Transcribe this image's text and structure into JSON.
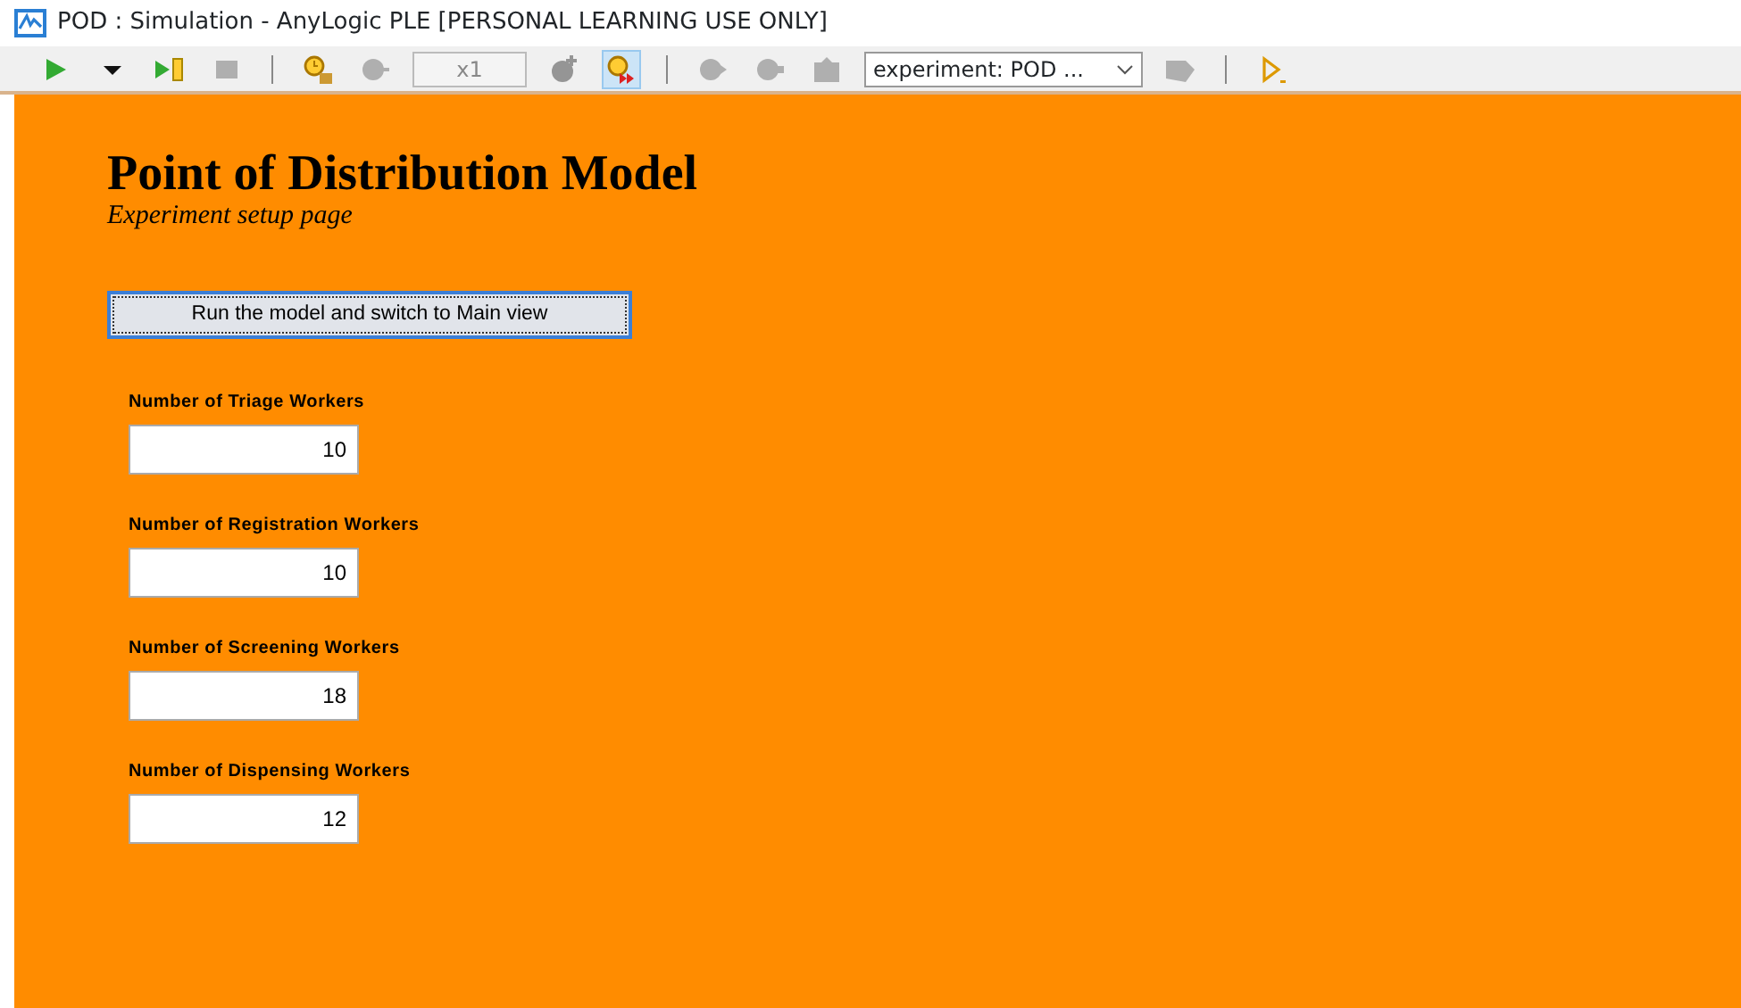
{
  "window": {
    "title": "POD : Simulation - AnyLogic PLE [PERSONAL LEARNING USE ONLY]"
  },
  "toolbar": [
    {
      "kind": "run",
      "disabled": false,
      "selected": false
    },
    {
      "kind": "dropdown",
      "disabled": false,
      "selected": false
    },
    {
      "kind": "step",
      "disabled": false,
      "selected": false
    },
    {
      "kind": "stop",
      "disabled": true,
      "selected": false
    },
    {
      "kind": "sep"
    },
    {
      "kind": "clock",
      "disabled": false,
      "selected": false
    },
    {
      "kind": "slower",
      "disabled": true,
      "selected": false
    },
    {
      "kind": "speed",
      "text": "x1",
      "disabled": true
    },
    {
      "kind": "faster",
      "disabled": true,
      "selected": false
    },
    {
      "kind": "fast",
      "disabled": false,
      "selected": true
    },
    {
      "kind": "sep"
    },
    {
      "kind": "back",
      "disabled": true,
      "selected": false
    },
    {
      "kind": "home",
      "disabled": true,
      "selected": false
    },
    {
      "kind": "up",
      "disabled": true,
      "selected": false
    },
    {
      "kind": "select",
      "text": "experiment: POD ..."
    },
    {
      "kind": "nav",
      "disabled": true,
      "selected": false
    },
    {
      "kind": "sep"
    },
    {
      "kind": "console",
      "disabled": false,
      "selected": false
    }
  ],
  "page": {
    "title": "Point of Distribution Model",
    "subtitle": "Experiment setup page",
    "run_button": "Run the model and switch to Main view",
    "parameters": [
      {
        "label": "Number of Triage Workers",
        "value": "10"
      },
      {
        "label": "Number of Registration Workers",
        "value": "10"
      },
      {
        "label": "Number of Screening Workers",
        "value": "18"
      },
      {
        "label": "Number of Dispensing Workers",
        "value": "12"
      }
    ]
  }
}
